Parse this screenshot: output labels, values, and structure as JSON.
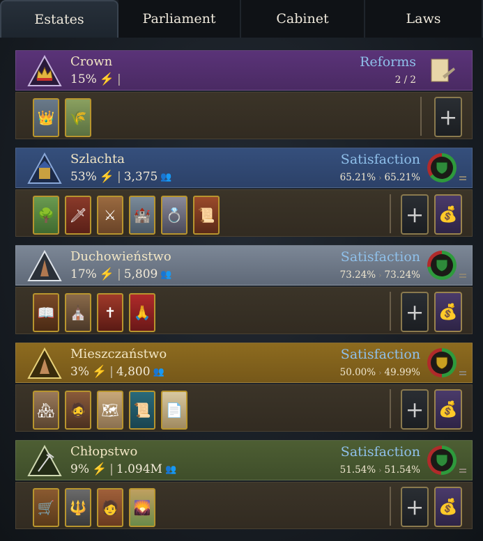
{
  "tabs": [
    "Estates",
    "Parliament",
    "Cabinet",
    "Laws"
  ],
  "crown": {
    "name": "Crown",
    "power": "15%",
    "reforms_label": "Reforms",
    "reforms_count": "2 / 2",
    "cards": [
      "👑",
      "🌾"
    ]
  },
  "estates": [
    {
      "name": "Szlachta",
      "power": "53%",
      "population": "3,375",
      "satisfaction_label": "Satisfaction",
      "sat_current": "65.21%",
      "sat_target": "65.21%",
      "satisfaction_level": 0.65,
      "cards": [
        "🌳",
        "🗡",
        "⚔",
        "🏰",
        "💍",
        "📜"
      ]
    },
    {
      "name": "Duchowieństwo",
      "power": "17%",
      "population": "5,809",
      "satisfaction_label": "Satisfaction",
      "sat_current": "73.24%",
      "sat_target": "73.24%",
      "satisfaction_level": 0.73,
      "cards": [
        "📖",
        "⛪",
        "✝",
        "🙏"
      ]
    },
    {
      "name": "Mieszczaństwo",
      "power": "3%",
      "population": "4,800",
      "satisfaction_label": "Satisfaction",
      "sat_current": "50.00%",
      "sat_target": "49.99%",
      "satisfaction_level": 0.5,
      "cards": [
        "🏘",
        "🧔",
        "🗺",
        "📜",
        "📄"
      ]
    },
    {
      "name": "Chłopstwo",
      "power": "9%",
      "population": "1.094M",
      "satisfaction_label": "Satisfaction",
      "sat_current": "51.54%",
      "sat_target": "51.54%",
      "satisfaction_level": 0.51,
      "cards": [
        "🛒",
        "🔱",
        "🧑",
        "🌄"
      ]
    }
  ],
  "icons": {
    "bolt": "⚡",
    "population": "👥",
    "add": "+",
    "privilege": "💰",
    "sat_arrow": "›"
  },
  "colors": {
    "crown": "#4a2a63",
    "szlachta": "#2c4168",
    "duchowienstwo": "#5f6978",
    "mieszczanstwo": "#765819",
    "chlopstwo": "#3f4e2a",
    "satisfaction_text": "#8fc0ea",
    "card_border": "#b8952e"
  }
}
